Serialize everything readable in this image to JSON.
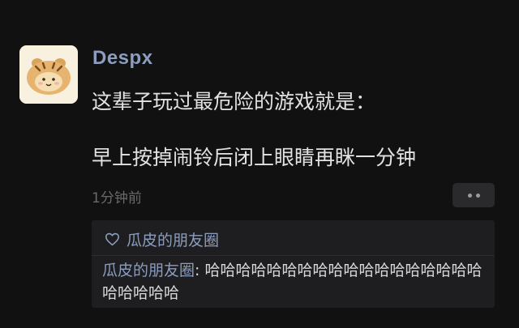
{
  "post": {
    "username": "Despx",
    "line1": "这辈子玩过最危险的游戏就是：",
    "line2": "早上按掉闹铃后闭上眼睛再眯一分钟",
    "timestamp": "1分钟前"
  },
  "interactions": {
    "like_icon": "heart-outline-icon",
    "likes": "瓜皮的朋友圈",
    "comment": {
      "author": "瓜皮的朋友圈",
      "separator": ": ",
      "text": "哈哈哈哈哈哈哈哈哈哈哈哈哈哈哈哈哈哈哈哈哈哈哈"
    }
  },
  "colors": {
    "background": "#111112",
    "name_link": "#8c9dbf",
    "body_text": "#e2e2e2",
    "muted": "#6a6a6d",
    "panel": "#1e1e20"
  }
}
